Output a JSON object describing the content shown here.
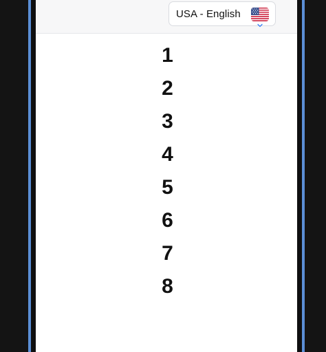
{
  "language_selector": {
    "label": "USA - English",
    "flag_icon": "us-flag-icon"
  },
  "items": [
    "1",
    "2",
    "3",
    "4",
    "5",
    "6",
    "7",
    "8"
  ],
  "colors": {
    "background": "#141414",
    "frame_accent": "#5b8fd6",
    "screen": "#ffffff",
    "header": "#f7f7f8",
    "chevron": "#3b82f6"
  }
}
